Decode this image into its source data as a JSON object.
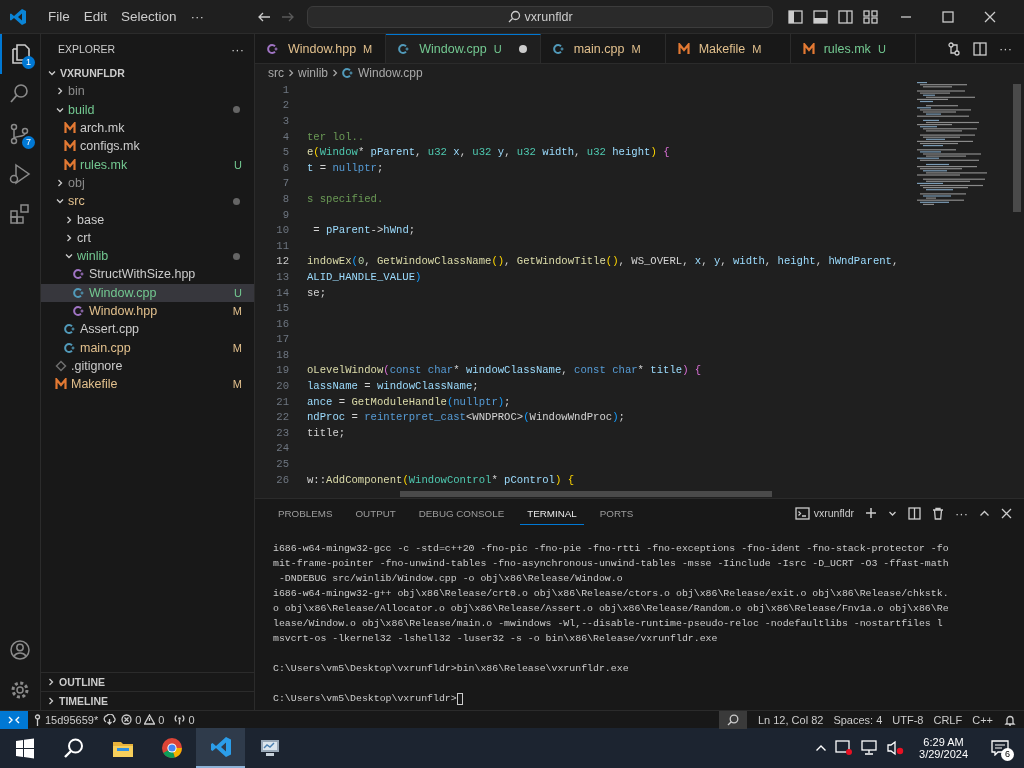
{
  "title_bar": {
    "menus": [
      {
        "label": "File"
      },
      {
        "label": "Edit"
      },
      {
        "label": "Selection"
      },
      {
        "label": "···"
      }
    ],
    "back_disabled": false,
    "forward_disabled": true,
    "command_center": "vxrunfldr"
  },
  "activity_bar": {
    "items": [
      {
        "kind": "explorer",
        "selected": true,
        "badge": "1"
      },
      {
        "kind": "search",
        "selected": false
      },
      {
        "kind": "source_control",
        "selected": false,
        "badge": "7"
      },
      {
        "kind": "run_debug",
        "selected": false
      },
      {
        "kind": "extensions",
        "selected": false
      }
    ],
    "bottom": [
      {
        "kind": "account"
      },
      {
        "kind": "settings"
      }
    ]
  },
  "sidebar": {
    "title": "EXPLORER",
    "more": "···",
    "root": {
      "label": "VXRUNFLDR",
      "expanded": true
    },
    "tree": [
      {
        "label": "bin",
        "kind": "folder",
        "expanded": false,
        "color": "#8c8c8c",
        "selected": false
      },
      {
        "label": "build",
        "kind": "folder",
        "expanded": true,
        "color": "#73c991",
        "dot": true,
        "selected": false,
        "children": [
          {
            "label": "arch.mk",
            "kind": "makefile",
            "color": "#cccccc",
            "selected": false
          },
          {
            "label": "configs.mk",
            "kind": "makefile",
            "color": "#cccccc",
            "selected": false
          },
          {
            "label": "rules.mk",
            "kind": "makefile",
            "color": "#73c991",
            "badge": "U",
            "selected": false
          }
        ]
      },
      {
        "label": "obj",
        "kind": "folder",
        "expanded": false,
        "color": "#8c8c8c",
        "selected": false
      },
      {
        "label": "src",
        "kind": "folder",
        "expanded": true,
        "color": "#e2c08d",
        "dot": true,
        "selected": false,
        "children": [
          {
            "label": "base",
            "kind": "folder",
            "expanded": false,
            "color": "#cccccc",
            "selected": false
          },
          {
            "label": "crt",
            "kind": "folder",
            "expanded": false,
            "color": "#cccccc",
            "selected": false
          },
          {
            "label": "winlib",
            "kind": "folder",
            "expanded": true,
            "color": "#73c991",
            "dot": true,
            "selected": false,
            "children": [
              {
                "label": "StructWithSize.hpp",
                "kind": "hpp",
                "color": "#cccccc",
                "selected": false
              },
              {
                "label": "Window.cpp",
                "kind": "cpp",
                "color": "#73c991",
                "badge": "U",
                "selected": true
              },
              {
                "label": "Window.hpp",
                "kind": "hpp",
                "color": "#e2c08d",
                "badge": "M",
                "selected": false
              }
            ]
          },
          {
            "label": "Assert.cpp",
            "kind": "cpp",
            "color": "#cccccc",
            "selected": false
          },
          {
            "label": "main.cpp",
            "kind": "cpp",
            "color": "#e2c08d",
            "badge": "M",
            "selected": false
          }
        ]
      },
      {
        "label": ".gitignore",
        "kind": "git",
        "color": "#cccccc",
        "selected": false
      },
      {
        "label": "Makefile",
        "kind": "makefile",
        "color": "#e2c08d",
        "badge": "M",
        "selected": false
      }
    ],
    "sections": [
      {
        "label": "OUTLINE",
        "expanded": false
      },
      {
        "label": "TIMELINE",
        "expanded": false
      }
    ]
  },
  "tabs": [
    {
      "label": "Window.hpp",
      "kind": "hpp",
      "color": "#e2c08d",
      "badge": "M",
      "selected": false,
      "dirty": false
    },
    {
      "label": "Window.cpp",
      "kind": "cpp",
      "color": "#73c991",
      "badge": "U",
      "selected": true,
      "dirty": true
    },
    {
      "label": "main.cpp",
      "kind": "cpp",
      "color": "#e2c08d",
      "badge": "M",
      "selected": false,
      "dirty": false
    },
    {
      "label": "Makefile",
      "kind": "makefile",
      "color": "#e2c08d",
      "badge": "M",
      "selected": false,
      "dirty": false
    },
    {
      "label": "rules.mk",
      "kind": "makefile",
      "color": "#73c991",
      "badge": "U",
      "selected": false,
      "dirty": false
    }
  ],
  "breadcrumb": [
    {
      "label": "src"
    },
    {
      "label": "winlib"
    },
    {
      "label": "Window.cpp",
      "kind": "cpp"
    }
  ],
  "editor": {
    "lines": [
      {
        "number": "1"
      },
      {
        "number": "2"
      },
      {
        "number": "3"
      },
      {
        "number": "4",
        "tokens": [
          {
            "text": "ter lol..",
            "kind": "comment"
          }
        ]
      },
      {
        "number": "5",
        "tokens": [
          {
            "text": "e",
            "kind": "func"
          },
          {
            "text": "(",
            "kind": "brace1"
          },
          {
            "text": "Window",
            "kind": "type"
          },
          {
            "text": "* ",
            "kind": "plain"
          },
          {
            "text": "pParent",
            "kind": "var"
          },
          {
            "text": ", ",
            "kind": "plain"
          },
          {
            "text": "u32",
            "kind": "type"
          },
          {
            "text": " x",
            "kind": "var"
          },
          {
            "text": ", ",
            "kind": "plain"
          },
          {
            "text": "u32",
            "kind": "type"
          },
          {
            "text": " y",
            "kind": "var"
          },
          {
            "text": ", ",
            "kind": "plain"
          },
          {
            "text": "u32",
            "kind": "type"
          },
          {
            "text": " width",
            "kind": "var"
          },
          {
            "text": ", ",
            "kind": "plain"
          },
          {
            "text": "u32",
            "kind": "type"
          },
          {
            "text": " height",
            "kind": "var"
          },
          {
            "text": ") ",
            "kind": "brace1"
          },
          {
            "text": "{",
            "kind": "brace2"
          }
        ]
      },
      {
        "number": "6",
        "tokens": [
          {
            "text": "t",
            "kind": "var"
          },
          {
            "text": " = ",
            "kind": "plain"
          },
          {
            "text": "nullptr",
            "kind": "kw"
          },
          {
            "text": ";",
            "kind": "plain"
          }
        ]
      },
      {
        "number": "7"
      },
      {
        "number": "8",
        "tokens": [
          {
            "text": "s specified.",
            "kind": "comment"
          }
        ]
      },
      {
        "number": "9"
      },
      {
        "number": "10",
        "tokens": [
          {
            "text": " = ",
            "kind": "plain"
          },
          {
            "text": "pParent",
            "kind": "var"
          },
          {
            "text": "->",
            "kind": "plain"
          },
          {
            "text": "hWnd",
            "kind": "var"
          },
          {
            "text": ";",
            "kind": "plain"
          }
        ]
      },
      {
        "number": "11"
      },
      {
        "number": "12",
        "current": true,
        "tokens": [
          {
            "text": "indowEx",
            "kind": "func"
          },
          {
            "text": "(",
            "kind": "brace3"
          },
          {
            "text": "0",
            "kind": "num"
          },
          {
            "text": ", ",
            "kind": "plain"
          },
          {
            "text": "GetWindowClassName",
            "kind": "func"
          },
          {
            "text": "()",
            "kind": "brace1"
          },
          {
            "text": ", ",
            "kind": "plain"
          },
          {
            "text": "GetWindowTitle",
            "kind": "func"
          },
          {
            "text": "()",
            "kind": "brace1"
          },
          {
            "text": ", WS_OVERL, ",
            "kind": "plain"
          },
          {
            "text": "x",
            "kind": "var"
          },
          {
            "text": ", ",
            "kind": "plain"
          },
          {
            "text": "y",
            "kind": "var"
          },
          {
            "text": ", ",
            "kind": "plain"
          },
          {
            "text": "width",
            "kind": "var"
          },
          {
            "text": ", ",
            "kind": "plain"
          },
          {
            "text": "height",
            "kind": "var"
          },
          {
            "text": ", ",
            "kind": "plain"
          },
          {
            "text": "hWndParent",
            "kind": "var"
          },
          {
            "text": ",",
            "kind": "plain"
          }
        ]
      },
      {
        "number": "13",
        "tokens": [
          {
            "text": "ALID_HANDLE_VALUE",
            "kind": "var"
          },
          {
            "text": ")",
            "kind": "brace3"
          }
        ]
      },
      {
        "number": "14",
        "tokens": [
          {
            "text": "se;",
            "kind": "plain"
          }
        ]
      },
      {
        "number": "15"
      },
      {
        "number": "16"
      },
      {
        "number": "17"
      },
      {
        "number": "18"
      },
      {
        "number": "19",
        "tokens": [
          {
            "text": "oLevelWindow",
            "kind": "func"
          },
          {
            "text": "(",
            "kind": "brace2"
          },
          {
            "text": "const char",
            "kind": "kw"
          },
          {
            "text": "* ",
            "kind": "plain"
          },
          {
            "text": "windowClassName",
            "kind": "var"
          },
          {
            "text": ", ",
            "kind": "plain"
          },
          {
            "text": "const char",
            "kind": "kw"
          },
          {
            "text": "* ",
            "kind": "plain"
          },
          {
            "text": "title",
            "kind": "var"
          },
          {
            "text": ") ",
            "kind": "brace2"
          },
          {
            "text": "{",
            "kind": "brace2"
          }
        ]
      },
      {
        "number": "20",
        "tokens": [
          {
            "text": "lassName",
            "kind": "var"
          },
          {
            "text": " = ",
            "kind": "plain"
          },
          {
            "text": "windowClassName",
            "kind": "var"
          },
          {
            "text": ";",
            "kind": "plain"
          }
        ]
      },
      {
        "number": "21",
        "tokens": [
          {
            "text": "ance",
            "kind": "var"
          },
          {
            "text": " = ",
            "kind": "plain"
          },
          {
            "text": "GetModuleHandle",
            "kind": "func"
          },
          {
            "text": "(",
            "kind": "brace3"
          },
          {
            "text": "nullptr",
            "kind": "kw"
          },
          {
            "text": ")",
            "kind": "brace3"
          },
          {
            "text": ";",
            "kind": "plain"
          }
        ]
      },
      {
        "number": "22",
        "tokens": [
          {
            "text": "ndProc",
            "kind": "var"
          },
          {
            "text": " = ",
            "kind": "plain"
          },
          {
            "text": "reinterpret_cast",
            "kind": "kw"
          },
          {
            "text": "<WNDPROC>",
            "kind": "plain"
          },
          {
            "text": "(",
            "kind": "brace3"
          },
          {
            "text": "WindowWndProc",
            "kind": "plain"
          },
          {
            "text": ")",
            "kind": "brace3"
          },
          {
            "text": ";",
            "kind": "plain"
          }
        ]
      },
      {
        "number": "23",
        "tokens": [
          {
            "text": "title;",
            "kind": "plain"
          }
        ]
      },
      {
        "number": "24"
      },
      {
        "number": "25"
      },
      {
        "number": "26",
        "tokens": [
          {
            "text": "w::",
            "kind": "plain"
          },
          {
            "text": "AddComponent",
            "kind": "func"
          },
          {
            "text": "(",
            "kind": "brace1"
          },
          {
            "text": "WindowControl",
            "kind": "type"
          },
          {
            "text": "* ",
            "kind": "plain"
          },
          {
            "text": "pControl",
            "kind": "var"
          },
          {
            "text": ") ",
            "kind": "brace1"
          },
          {
            "text": "{",
            "kind": "brace1"
          }
        ]
      }
    ]
  },
  "panel": {
    "tabs": [
      {
        "label": "PROBLEMS",
        "selected": false
      },
      {
        "label": "OUTPUT",
        "selected": false
      },
      {
        "label": "DEBUG CONSOLE",
        "selected": false
      },
      {
        "label": "TERMINAL",
        "selected": true
      },
      {
        "label": "PORTS",
        "selected": false
      }
    ],
    "terminal_name": "vxrunfldr",
    "groups": [
      {
        "lines": [
          "i686-w64-mingw32-gcc -c -std=c++20 -fno-pic -fno-pie -fno-rtti -fno-exceptions -fno-ident -fno-stack-protector -fo",
          "mit-frame-pointer -fno-unwind-tables -fno-asynchronous-unwind-tables -msse -Iinclude -Isrc -D_UCRT -O3 -ffast-math",
          " -DNDEBUG src/winlib/Window.cpp -o obj\\x86\\Release/Window.o",
          "i686-w64-mingw32-g++ obj\\x86\\Release/crt0.o obj\\x86\\Release/ctors.o obj\\x86\\Release/exit.o obj\\x86\\Release/chkstk.",
          "o obj\\x86\\Release/Allocator.o obj\\x86\\Release/Assert.o obj\\x86\\Release/Random.o obj\\x86\\Release/Fnv1a.o obj\\x86\\Re",
          "lease/Window.o obj\\x86\\Release/main.o -mwindows -Wl,--disable-runtime-pseudo-reloc -nodefaultlibs -nostartfiles l",
          "msvcrt-os -lkernel32 -lshell32 -luser32 -s -o bin\\x86\\Release/vxrunfldr.exe"
        ]
      },
      {
        "lines": [
          "C:\\Users\\vm5\\Desktop\\vxrunfldr>bin\\x86\\Release\\vxrunfldr.exe"
        ]
      },
      {
        "lines": [
          "C:\\Users\\vm5\\Desktop\\vxrunfldr>"
        ],
        "cursor": true
      }
    ]
  },
  "status_bar": {
    "branch": "15d95659*",
    "errors": "0",
    "warnings": "0",
    "ports": "0",
    "items": [
      {
        "label": "Ln 12, Col 82"
      },
      {
        "label": "Spaces: 4"
      },
      {
        "label": "UTF-8"
      },
      {
        "label": "CRLF"
      },
      {
        "label": "C++"
      }
    ]
  },
  "taskbar": {
    "apps": [
      {
        "kind": "start",
        "selected": false
      },
      {
        "kind": "search",
        "selected": false
      },
      {
        "kind": "files",
        "selected": false
      },
      {
        "kind": "browser",
        "selected": false
      },
      {
        "kind": "code",
        "selected": true
      },
      {
        "kind": "monitor",
        "selected": false
      }
    ],
    "time": "6:29 AM",
    "date": "3/29/2024",
    "notifications": "6"
  }
}
